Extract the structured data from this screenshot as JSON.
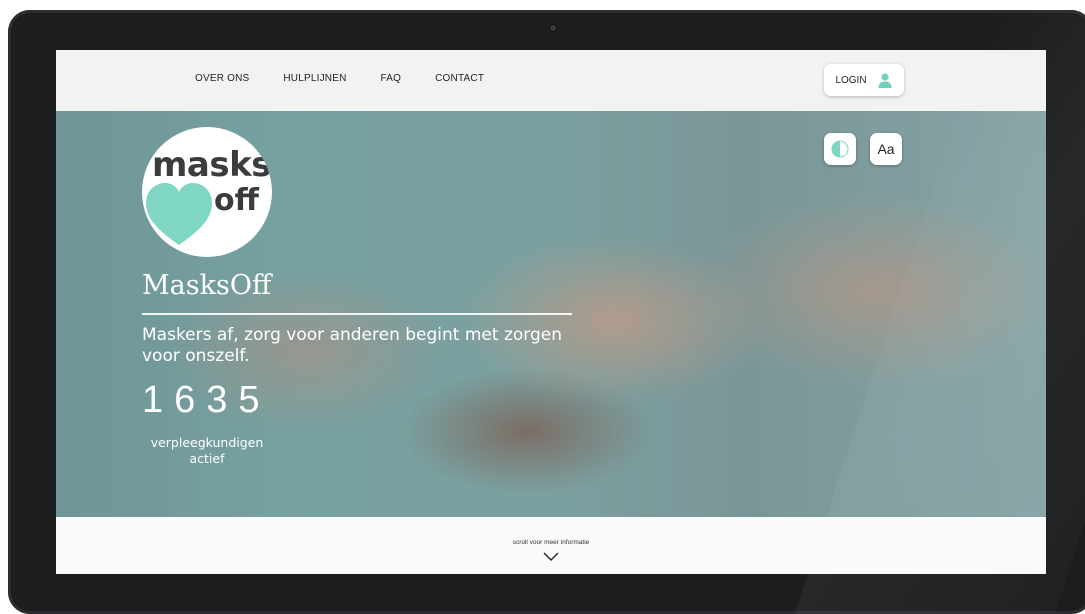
{
  "nav": {
    "links": [
      "OVER ONS",
      "HULPLIJNEN",
      "FAQ",
      "CONTACT"
    ],
    "login_label": "LOGIN"
  },
  "controls": {
    "font_size_label": "Aa"
  },
  "logo": {
    "line1": "masks",
    "line2": "off"
  },
  "hero": {
    "brand": "MasksOff",
    "tagline": "Maskers af, zorg voor anderen begint met zorgen voor onszelf.",
    "counter": "1635",
    "counter_label": "verpleegkundigen actief"
  },
  "footer": {
    "scroll_text": "scroll voor meer informatie"
  },
  "colors": {
    "accent": "#7fd6c3",
    "logo_text": "#3c3c3c",
    "nav_bg": "#f2f2f2"
  },
  "icons": {
    "login": "user-icon",
    "contrast": "contrast-icon",
    "scroll": "chevron-down-icon"
  }
}
